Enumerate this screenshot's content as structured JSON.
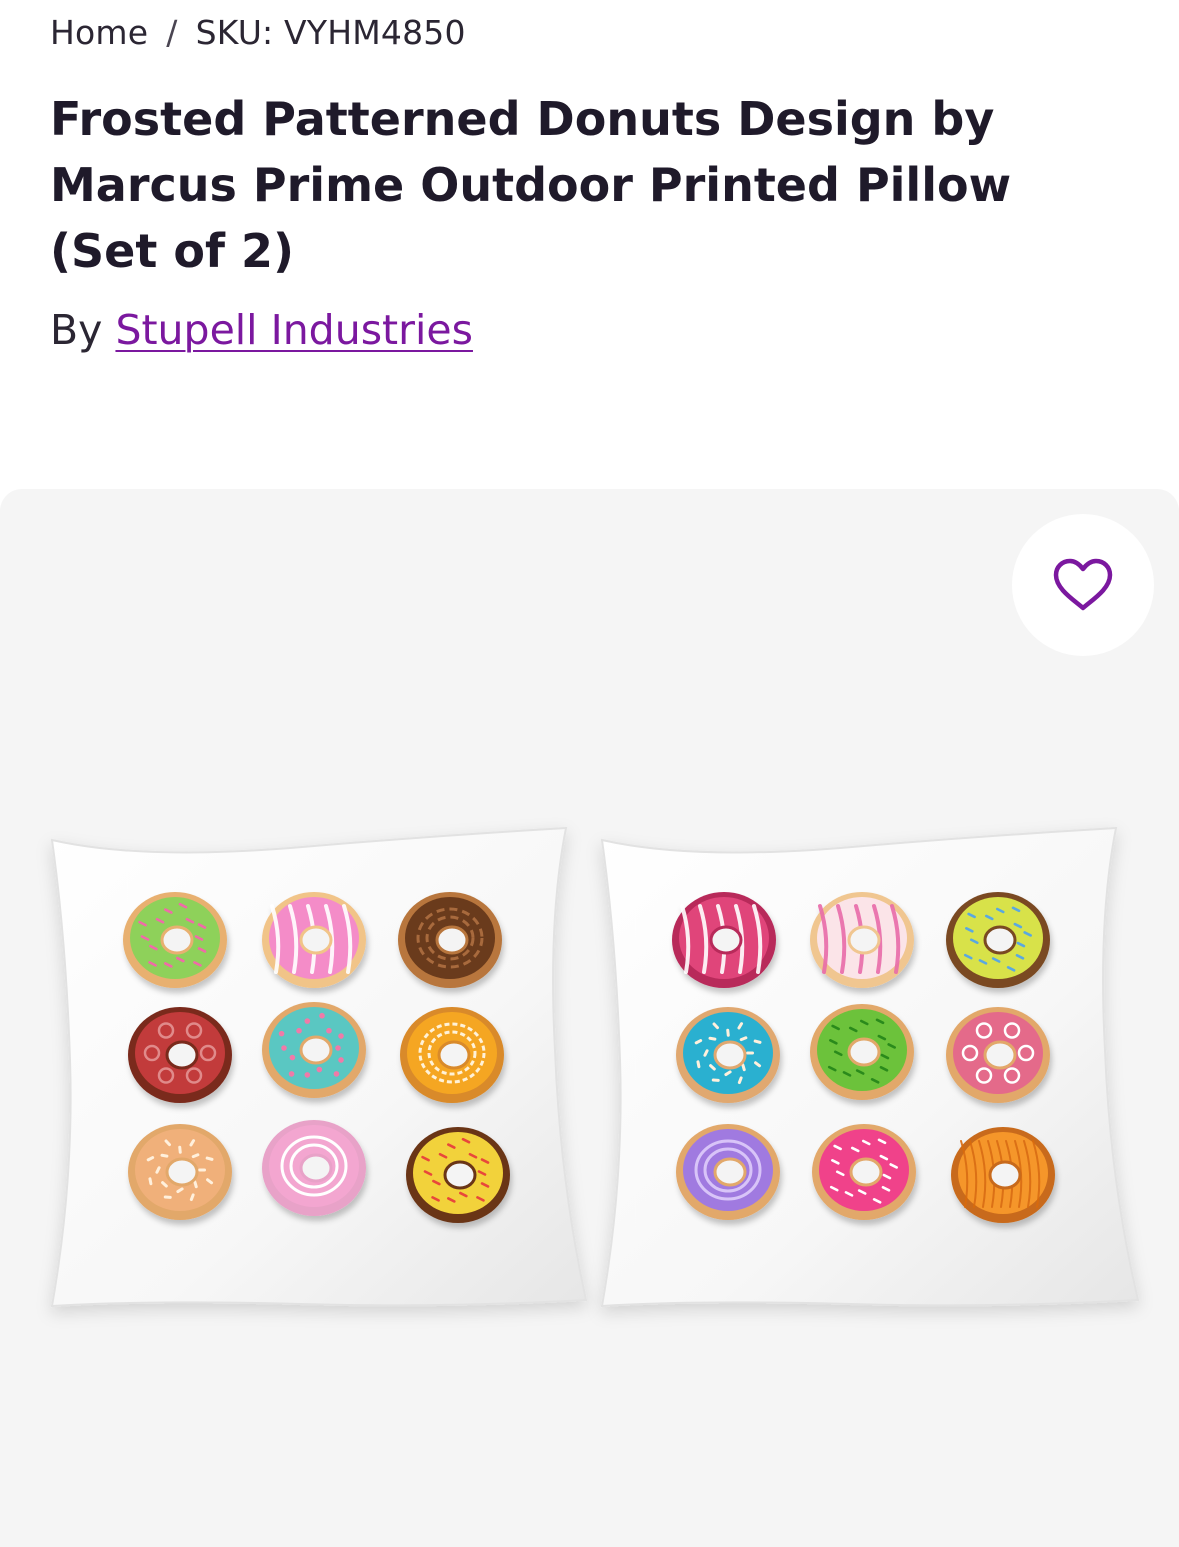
{
  "breadcrumb": {
    "home": "Home",
    "separator": "/",
    "sku": "SKU: VYHM4850"
  },
  "product": {
    "title": "Frosted Patterned Donuts Design by Marcus Prime Outdoor Printed Pillow (Set of 2)",
    "by_prefix": "By",
    "brand": "Stupell Industries"
  },
  "favorite": {
    "icon": "heart-outline-icon"
  },
  "colors": {
    "brand": "#7b189f",
    "text": "#1f1a2a",
    "gallery_bg": "#f5f5f5"
  },
  "pillows": [
    {
      "donuts": [
        {
          "dough": "#e8b070",
          "icing": "#8ed15a",
          "decor": "sprinkles",
          "decor_color": "#f06ba8"
        },
        {
          "dough": "#f1c488",
          "icing": "#f48cc8",
          "decor": "stripes",
          "decor_color": "#ffffff"
        },
        {
          "dough": "#b8763c",
          "icing": "#6a3a1c",
          "decor": "zigzag",
          "decor_color": "#a86a3c"
        },
        {
          "dough": "#7a2b1c",
          "icing": "#c23a3a",
          "decor": "swirls",
          "decor_color": "#e08a8a"
        },
        {
          "dough": "#e2a86a",
          "icing": "#5ac7c2",
          "decor": "dots",
          "decor_color": "#f07aa8"
        },
        {
          "dough": "#d98a2a",
          "icing": "#f5a623",
          "decor": "waves",
          "decor_color": "#fff2d8"
        },
        {
          "dough": "#e2a86a",
          "icing": "#f0b07a",
          "decor": "flakes",
          "decor_color": "#fff0dc"
        },
        {
          "dough": "#e8a2c8",
          "icing": "#f3a6d0",
          "decor": "rings",
          "decor_color": "#ffffff"
        },
        {
          "dough": "#6a3418",
          "icing": "#f2d23a",
          "decor": "sprinkles",
          "decor_color": "#e8473a"
        }
      ]
    },
    {
      "donuts": [
        {
          "dough": "#b8295a",
          "icing": "#e0457a",
          "decor": "drizzle",
          "decor_color": "#ffffff"
        },
        {
          "dough": "#f0c690",
          "icing": "#fbe4e8",
          "decor": "stripes",
          "decor_color": "#e86aa8"
        },
        {
          "dough": "#7a4a24",
          "icing": "#d8e24a",
          "decor": "sprinkles",
          "decor_color": "#5aa8e0"
        },
        {
          "dough": "#e0a870",
          "icing": "#2ab0d0",
          "decor": "flakes",
          "decor_color": "#fff0dc"
        },
        {
          "dough": "#e2a86a",
          "icing": "#6cc23a",
          "decor": "sprinkles",
          "decor_color": "#2a8a1a"
        },
        {
          "dough": "#e2a86a",
          "icing": "#e46a8a",
          "decor": "swirls",
          "decor_color": "#ffffff"
        },
        {
          "dough": "#e2a86a",
          "icing": "#a07ae0",
          "decor": "rings",
          "decor_color": "#d8c4f8"
        },
        {
          "dough": "#e2a86a",
          "icing": "#f0428a",
          "decor": "sprinkles",
          "decor_color": "#ffffff"
        },
        {
          "dough": "#c86a1a",
          "icing": "#f5962a",
          "decor": "lines",
          "decor_color": "#d86a10"
        }
      ]
    }
  ]
}
